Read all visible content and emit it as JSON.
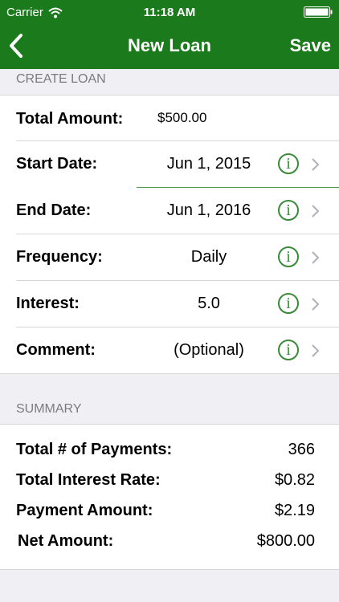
{
  "status": {
    "carrier": "Carrier",
    "time": "11:18 AM"
  },
  "nav": {
    "title": "New Loan",
    "save": "Save"
  },
  "create_section": {
    "header": "CREATE LOAN",
    "rows": [
      {
        "label": "Total Amount:",
        "value": "$500.00"
      },
      {
        "label": "Start Date:",
        "value": "Jun 1, 2015"
      },
      {
        "label": "End Date:",
        "value": "Jun 1, 2016"
      },
      {
        "label": "Frequency:",
        "value": "Daily"
      },
      {
        "label": "Interest:",
        "value": "5.0"
      },
      {
        "label": "Comment:",
        "value": "(Optional)"
      }
    ]
  },
  "summary_section": {
    "header": "SUMMARY",
    "rows": [
      {
        "label": "Total # of Payments:",
        "value": "366"
      },
      {
        "label": "Total Interest Rate:",
        "value": "$0.82"
      },
      {
        "label": "Payment Amount:",
        "value": "$2.19"
      },
      {
        "label": "Net Amount:",
        "value": "$800.00"
      }
    ]
  },
  "colors": {
    "brand": "#1b7a1b",
    "info": "#3a8a3a",
    "background": "#efeff4"
  }
}
